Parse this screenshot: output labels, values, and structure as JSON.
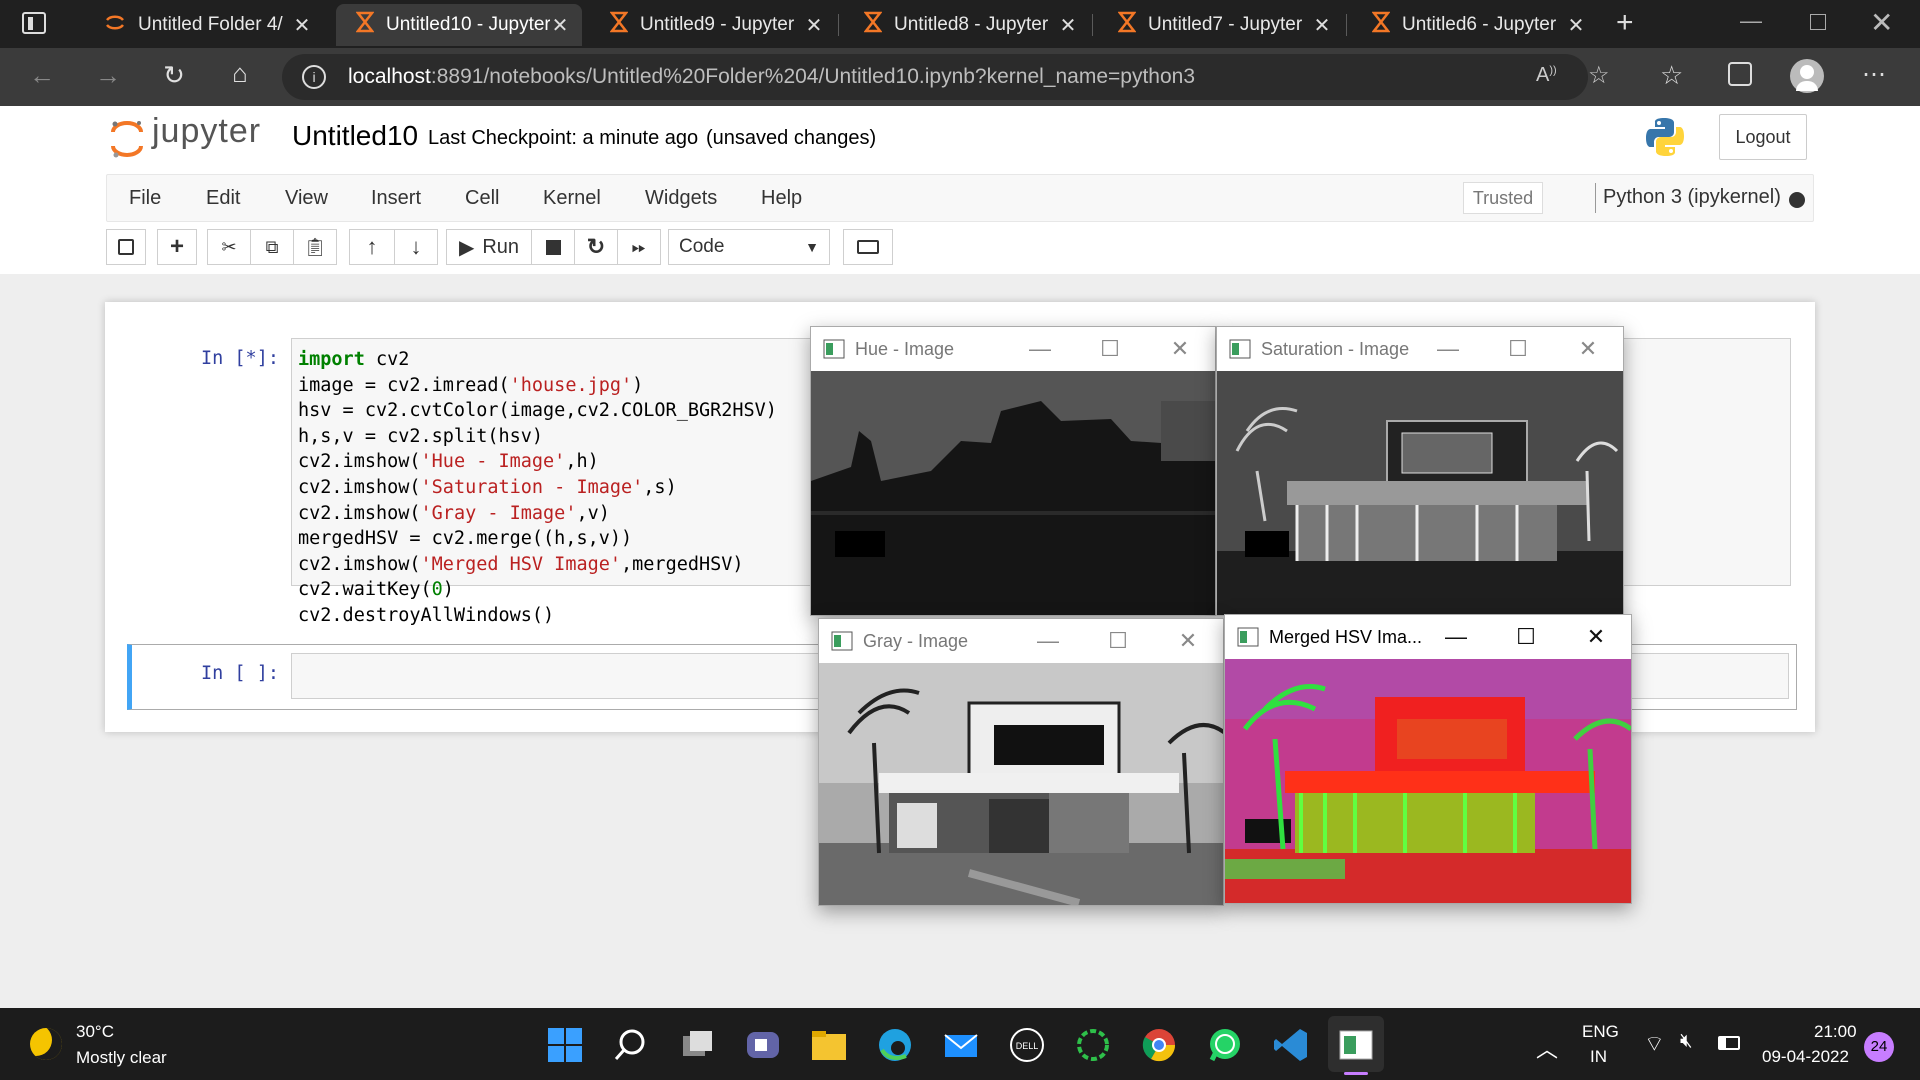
{
  "browser": {
    "tabs": [
      {
        "label": "Untitled Folder 4/",
        "active": false,
        "icon": "jupyter-logo-icon"
      },
      {
        "label": "Untitled10 - Jupyter",
        "active": true,
        "icon": "hourglass-icon"
      },
      {
        "label": "Untitled9 - Jupyter",
        "active": false,
        "icon": "hourglass-icon"
      },
      {
        "label": "Untitled8 - Jupyter",
        "active": false,
        "icon": "hourglass-icon"
      },
      {
        "label": "Untitled7 - Jupyter",
        "active": false,
        "icon": "hourglass-icon"
      },
      {
        "label": "Untitled6 - Jupyter",
        "active": false,
        "icon": "hourglass-icon"
      }
    ],
    "url_host": "localhost",
    "url_rest": ":8891/notebooks/Untitled%20Folder%204/Untitled10.ipynb?kernel_name=python3"
  },
  "jupyter": {
    "logo_text": "jupyter",
    "notebook_name": "Untitled10",
    "checkpoint": "Last Checkpoint: a minute ago",
    "unsaved": "(unsaved changes)",
    "logout_label": "Logout",
    "menu": [
      "File",
      "Edit",
      "View",
      "Insert",
      "Cell",
      "Kernel",
      "Widgets",
      "Help"
    ],
    "trusted_label": "Trusted",
    "kernel_label": "Python 3 (ipykernel)",
    "run_label": "Run",
    "cell_type": "Code",
    "cells": [
      {
        "prompt": "In [*]:",
        "lines": [
          [
            {
              "t": "import",
              "c": "kw"
            },
            {
              "t": " cv2",
              "c": ""
            }
          ],
          [
            {
              "t": "image = cv2.imread(",
              "c": ""
            },
            {
              "t": "'house.jpg'",
              "c": "str"
            },
            {
              "t": ")",
              "c": ""
            }
          ],
          [
            {
              "t": "hsv = cv2.cvtColor(image,cv2.COLOR_BGR2HSV)",
              "c": ""
            }
          ],
          [
            {
              "t": "h,s,v = cv2.split(hsv)",
              "c": ""
            }
          ],
          [
            {
              "t": "cv2.imshow(",
              "c": ""
            },
            {
              "t": "'Hue - Image'",
              "c": "str"
            },
            {
              "t": ",h)",
              "c": ""
            }
          ],
          [
            {
              "t": "cv2.imshow(",
              "c": ""
            },
            {
              "t": "'Saturation - Image'",
              "c": "str"
            },
            {
              "t": ",s)",
              "c": ""
            }
          ],
          [
            {
              "t": "cv2.imshow(",
              "c": ""
            },
            {
              "t": "'Gray - Image'",
              "c": "str"
            },
            {
              "t": ",v)",
              "c": ""
            }
          ],
          [
            {
              "t": "mergedHSV = cv2.merge((h,s,v))",
              "c": ""
            }
          ],
          [
            {
              "t": "cv2.imshow(",
              "c": ""
            },
            {
              "t": "'Merged HSV Image'",
              "c": "str"
            },
            {
              "t": ",mergedHSV)",
              "c": ""
            }
          ],
          [
            {
              "t": "cv2.waitKey(",
              "c": ""
            },
            {
              "t": "0",
              "c": "num"
            },
            {
              "t": ")",
              "c": ""
            }
          ],
          [
            {
              "t": "cv2.destroyAllWindows()",
              "c": ""
            }
          ]
        ]
      },
      {
        "prompt": "In [ ]:",
        "lines": []
      }
    ]
  },
  "cv_windows": [
    {
      "title": "Hue - Image",
      "style": "hue"
    },
    {
      "title": "Saturation - Image",
      "style": "sat"
    },
    {
      "title": "Gray - Image",
      "style": "gray"
    },
    {
      "title": "Merged HSV Ima...",
      "style": "merged"
    }
  ],
  "taskbar": {
    "weather_temp": "30°C",
    "weather_desc": "Mostly clear",
    "lang_top": "ENG",
    "lang_bottom": "IN",
    "time": "21:00",
    "date": "09-04-2022",
    "notif_count": "24"
  },
  "colors": {
    "jupyter_orange": "#f37726",
    "prompt_blue": "#303f9f",
    "selected_cell": "#42a5f5"
  }
}
